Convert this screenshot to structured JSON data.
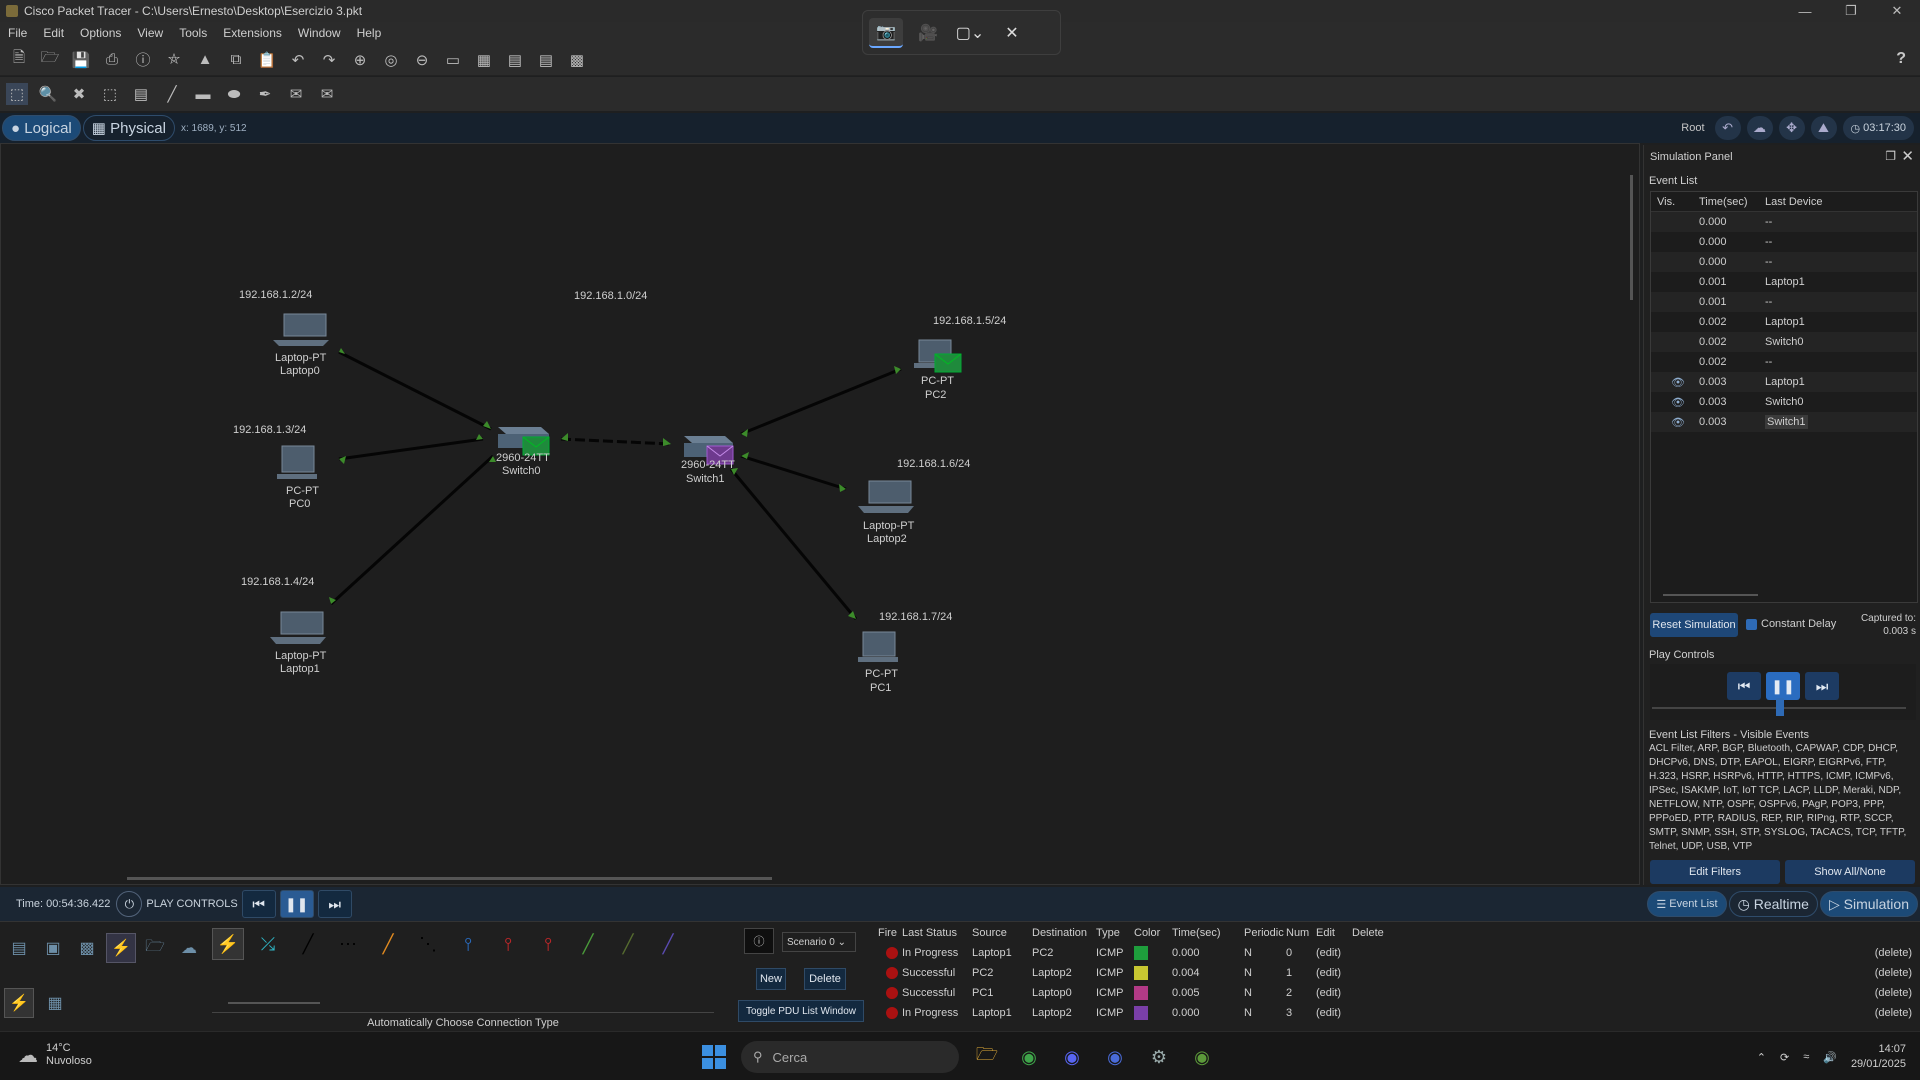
{
  "window": {
    "title": "Cisco Packet Tracer - C:\\Users\\Ernesto\\Desktop\\Esercizio 3.pkt"
  },
  "menu": [
    "File",
    "Edit",
    "Options",
    "View",
    "Tools",
    "Extensions",
    "Window",
    "Help"
  ],
  "modebar": {
    "logical": "Logical",
    "physical": "Physical",
    "coords": "x: 1689, y: 512",
    "root": "Root",
    "clock": "03:17:30"
  },
  "network": {
    "net_label": "192.168.1.0/24",
    "devices": [
      {
        "type": "Laptop-PT",
        "name": "Laptop0",
        "ip": "192.168.1.2/24"
      },
      {
        "type": "PC-PT",
        "name": "PC0",
        "ip": "192.168.1.3/24"
      },
      {
        "type": "Laptop-PT",
        "name": "Laptop1",
        "ip": "192.168.1.4/24"
      },
      {
        "type": "2960-24TT",
        "name": "Switch0",
        "ip": ""
      },
      {
        "type": "2960-24TT",
        "name": "Switch1",
        "ip": ""
      },
      {
        "type": "PC-PT",
        "name": "PC2",
        "ip": "192.168.1.5/24"
      },
      {
        "type": "Laptop-PT",
        "name": "Laptop2",
        "ip": "192.168.1.6/24"
      },
      {
        "type": "PC-PT",
        "name": "PC1",
        "ip": "192.168.1.7/24"
      }
    ],
    "switch_label_0": "2960-24TT",
    "switch_label_1": "2960-24TT"
  },
  "sim_panel": {
    "title": "Simulation Panel",
    "event_list_label": "Event List",
    "headers": {
      "vis": "Vis.",
      "time": "Time(sec)",
      "device": "Last Device"
    },
    "events": [
      {
        "vis": "",
        "time": "0.000",
        "device": "--"
      },
      {
        "vis": "",
        "time": "0.000",
        "device": "--"
      },
      {
        "vis": "",
        "time": "0.000",
        "device": "--"
      },
      {
        "vis": "",
        "time": "0.001",
        "device": "Laptop1"
      },
      {
        "vis": "",
        "time": "0.001",
        "device": "--"
      },
      {
        "vis": "",
        "time": "0.002",
        "device": "Laptop1"
      },
      {
        "vis": "",
        "time": "0.002",
        "device": "Switch0"
      },
      {
        "vis": "",
        "time": "0.002",
        "device": "--"
      },
      {
        "vis": "eye",
        "time": "0.003",
        "device": "Laptop1"
      },
      {
        "vis": "eye",
        "time": "0.003",
        "device": "Switch0"
      },
      {
        "vis": "eye",
        "time": "0.003",
        "device": "Switch1"
      }
    ],
    "reset": "Reset Simulation",
    "constant_delay": "Constant Delay",
    "captured_to": "Captured to:",
    "captured_val": "0.003 s",
    "play_controls": "Play Controls",
    "filters_label": "Event List Filters - Visible Events",
    "filters": "ACL Filter, ARP, BGP, Bluetooth, CAPWAP, CDP, DHCP, DHCPv6, DNS, DTP, EAPOL, EIGRP, EIGRPv6, FTP, H.323, HSRP, HSRPv6, HTTP, HTTPS, ICMP, ICMPv6, IPSec, ISAKMP, IoT, IoT TCP, LACP, LLDP, Meraki, NDP, NETFLOW, NTP, OSPF, OSPFv6, PAgP, POP3, PPP, PPPoED, PTP, RADIUS, REP, RIP, RIPng, RTP, SCCP, SMTP, SNMP, SSH, STP, SYSLOG, TACACS, TCP, TFTP, Telnet, UDP, USB, VTP",
    "edit_filters": "Edit Filters",
    "show_all": "Show All/None"
  },
  "bottom": {
    "time": "Time: 00:54:36.422",
    "play_controls": "PLAY CONTROLS",
    "event_list": "Event List",
    "realtime": "Realtime",
    "simulation": "Simulation",
    "auto_conn": "Automatically Choose Connection Type"
  },
  "pdu": {
    "scenario": "Scenario 0",
    "new": "New",
    "delete": "Delete",
    "toggle": "Toggle PDU List Window",
    "headers": {
      "fire": "Fire",
      "status": "Last Status",
      "src": "Source",
      "dst": "Destination",
      "type": "Type",
      "color": "Color",
      "time": "Time(sec)",
      "periodic": "Periodic",
      "num": "Num",
      "edit": "Edit",
      "delete": "Delete"
    },
    "rows": [
      {
        "status": "In Progress",
        "src": "Laptop1",
        "dst": "PC2",
        "type": "ICMP",
        "color": "#1e9e3c",
        "time": "0.000",
        "periodic": "N",
        "num": "0",
        "edit": "(edit)",
        "delete": "(delete)"
      },
      {
        "status": "Successful",
        "src": "PC2",
        "dst": "Laptop2",
        "type": "ICMP",
        "color": "#c7c631",
        "time": "0.004",
        "periodic": "N",
        "num": "1",
        "edit": "(edit)",
        "delete": "(delete)"
      },
      {
        "status": "Successful",
        "src": "PC1",
        "dst": "Laptop0",
        "type": "ICMP",
        "color": "#b23a86",
        "time": "0.005",
        "periodic": "N",
        "num": "2",
        "edit": "(edit)",
        "delete": "(delete)"
      },
      {
        "status": "In Progress",
        "src": "Laptop1",
        "dst": "Laptop2",
        "type": "ICMP",
        "color": "#7a3fa8",
        "time": "0.000",
        "periodic": "N",
        "num": "3",
        "edit": "(edit)",
        "delete": "(delete)"
      }
    ]
  },
  "taskbar": {
    "temp": "14°C",
    "weather": "Nuvoloso",
    "search": "Cerca",
    "time": "14:07",
    "date": "29/01/2025"
  }
}
